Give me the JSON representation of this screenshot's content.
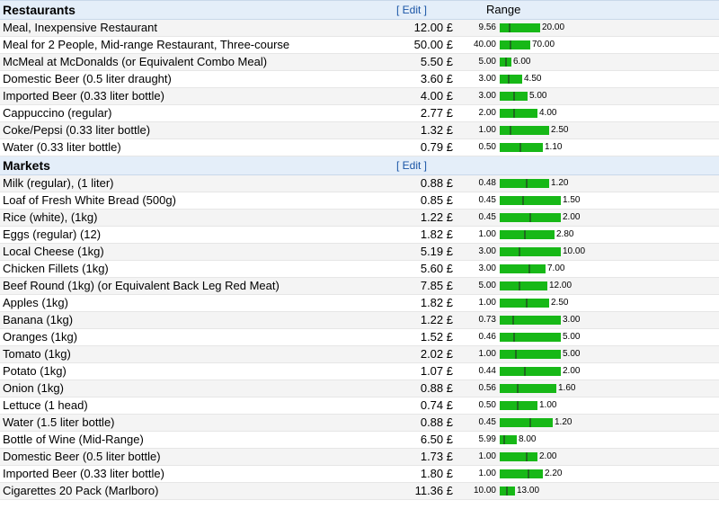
{
  "sections": [
    {
      "title": "Restaurants",
      "edit_label": "[ Edit ]",
      "range_header": "Range",
      "rows": [
        {
          "name": "Meal, Inexpensive Restaurant",
          "price": "12.00 £",
          "value": 12.0,
          "min": "9.56",
          "max": "20.00",
          "min_v": 9.56,
          "max_v": 20.0
        },
        {
          "name": "Meal for 2 People, Mid-range Restaurant, Three-course",
          "price": "50.00 £",
          "value": 50.0,
          "min": "40.00",
          "max": "70.00",
          "min_v": 40.0,
          "max_v": 70.0
        },
        {
          "name": "McMeal at McDonalds (or Equivalent Combo Meal)",
          "price": "5.50 £",
          "value": 5.5,
          "min": "5.00",
          "max": "6.00",
          "min_v": 5.0,
          "max_v": 6.0
        },
        {
          "name": "Domestic Beer (0.5 liter draught)",
          "price": "3.60 £",
          "value": 3.6,
          "min": "3.00",
          "max": "4.50",
          "min_v": 3.0,
          "max_v": 4.5
        },
        {
          "name": "Imported Beer (0.33 liter bottle)",
          "price": "4.00 £",
          "value": 4.0,
          "min": "3.00",
          "max": "5.00",
          "min_v": 3.0,
          "max_v": 5.0
        },
        {
          "name": "Cappuccino (regular)",
          "price": "2.77 £",
          "value": 2.77,
          "min": "2.00",
          "max": "4.00",
          "min_v": 2.0,
          "max_v": 4.0
        },
        {
          "name": "Coke/Pepsi (0.33 liter bottle)",
          "price": "1.32 £",
          "value": 1.32,
          "min": "1.00",
          "max": "2.50",
          "min_v": 1.0,
          "max_v": 2.5
        },
        {
          "name": "Water (0.33 liter bottle)",
          "price": "0.79 £",
          "value": 0.79,
          "min": "0.50",
          "max": "1.10",
          "min_v": 0.5,
          "max_v": 1.1
        }
      ]
    },
    {
      "title": "Markets",
      "edit_label": "[ Edit ]",
      "range_header": "",
      "rows": [
        {
          "name": "Milk (regular), (1 liter)",
          "price": "0.88 £",
          "value": 0.88,
          "min": "0.48",
          "max": "1.20",
          "min_v": 0.48,
          "max_v": 1.2
        },
        {
          "name": "Loaf of Fresh White Bread (500g)",
          "price": "0.85 £",
          "value": 0.85,
          "min": "0.45",
          "max": "1.50",
          "min_v": 0.45,
          "max_v": 1.5
        },
        {
          "name": "Rice (white), (1kg)",
          "price": "1.22 £",
          "value": 1.22,
          "min": "0.45",
          "max": "2.00",
          "min_v": 0.45,
          "max_v": 2.0
        },
        {
          "name": "Eggs (regular) (12)",
          "price": "1.82 £",
          "value": 1.82,
          "min": "1.00",
          "max": "2.80",
          "min_v": 1.0,
          "max_v": 2.8
        },
        {
          "name": "Local Cheese (1kg)",
          "price": "5.19 £",
          "value": 5.19,
          "min": "3.00",
          "max": "10.00",
          "min_v": 3.0,
          "max_v": 10.0
        },
        {
          "name": "Chicken Fillets (1kg)",
          "price": "5.60 £",
          "value": 5.6,
          "min": "3.00",
          "max": "7.00",
          "min_v": 3.0,
          "max_v": 7.0
        },
        {
          "name": "Beef Round (1kg) (or Equivalent Back Leg Red Meat)",
          "price": "7.85 £",
          "value": 7.85,
          "min": "5.00",
          "max": "12.00",
          "min_v": 5.0,
          "max_v": 12.0
        },
        {
          "name": "Apples (1kg)",
          "price": "1.82 £",
          "value": 1.82,
          "min": "1.00",
          "max": "2.50",
          "min_v": 1.0,
          "max_v": 2.5
        },
        {
          "name": "Banana (1kg)",
          "price": "1.22 £",
          "value": 1.22,
          "min": "0.73",
          "max": "3.00",
          "min_v": 0.73,
          "max_v": 3.0
        },
        {
          "name": "Oranges (1kg)",
          "price": "1.52 £",
          "value": 1.52,
          "min": "0.46",
          "max": "5.00",
          "min_v": 0.46,
          "max_v": 5.0
        },
        {
          "name": "Tomato (1kg)",
          "price": "2.02 £",
          "value": 2.02,
          "min": "1.00",
          "max": "5.00",
          "min_v": 1.0,
          "max_v": 5.0
        },
        {
          "name": "Potato (1kg)",
          "price": "1.07 £",
          "value": 1.07,
          "min": "0.44",
          "max": "2.00",
          "min_v": 0.44,
          "max_v": 2.0
        },
        {
          "name": "Onion (1kg)",
          "price": "0.88 £",
          "value": 0.88,
          "min": "0.56",
          "max": "1.60",
          "min_v": 0.56,
          "max_v": 1.6
        },
        {
          "name": "Lettuce (1 head)",
          "price": "0.74 £",
          "value": 0.74,
          "min": "0.50",
          "max": "1.00",
          "min_v": 0.5,
          "max_v": 1.0
        },
        {
          "name": "Water (1.5 liter bottle)",
          "price": "0.88 £",
          "value": 0.88,
          "min": "0.45",
          "max": "1.20",
          "min_v": 0.45,
          "max_v": 1.2
        },
        {
          "name": "Bottle of Wine (Mid-Range)",
          "price": "6.50 £",
          "value": 6.5,
          "min": "5.99",
          "max": "8.00",
          "min_v": 5.99,
          "max_v": 8.0
        },
        {
          "name": "Domestic Beer (0.5 liter bottle)",
          "price": "1.73 £",
          "value": 1.73,
          "min": "1.00",
          "max": "2.00",
          "min_v": 1.0,
          "max_v": 2.0
        },
        {
          "name": "Imported Beer (0.33 liter bottle)",
          "price": "1.80 £",
          "value": 1.8,
          "min": "1.00",
          "max": "2.20",
          "min_v": 1.0,
          "max_v": 2.2
        },
        {
          "name": "Cigarettes 20 Pack (Marlboro)",
          "price": "11.36 £",
          "value": 11.36,
          "min": "10.00",
          "max": "13.00",
          "min_v": 10.0,
          "max_v": 13.0
        }
      ]
    }
  ],
  "colors": {
    "bar": "#17b817",
    "tick": "#1e6b1e",
    "header_bg": "#e4eef9",
    "edit_link": "#1a55a6"
  }
}
